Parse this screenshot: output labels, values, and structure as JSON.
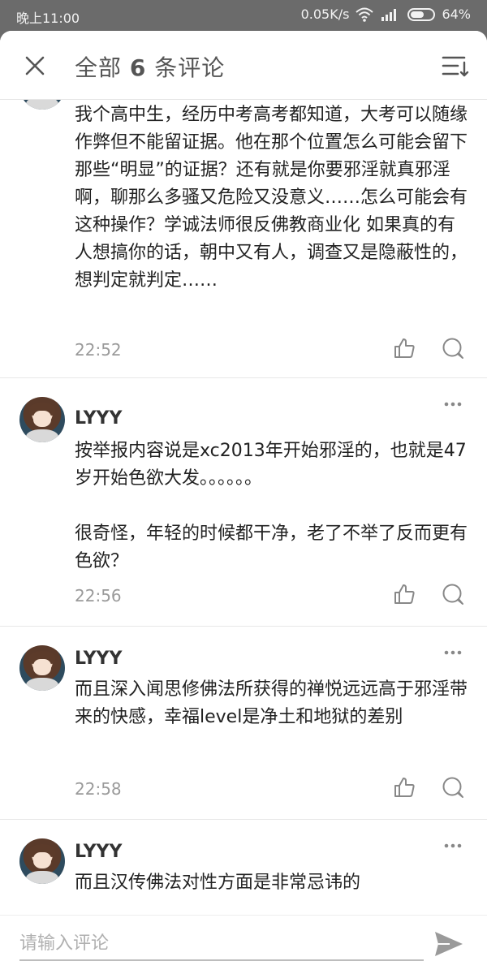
{
  "status_bar": {
    "time": "晚上11:00",
    "network_speed": "0.05K/s",
    "battery": "64%"
  },
  "header": {
    "title_prefix": "全部 ",
    "count": "6",
    "title_suffix": " 条评论"
  },
  "comments": [
    {
      "username": "",
      "text": "我个高中生，经历中考高考都知道，大考可以随缘作弊但不能留证据。他在那个位置怎么可能会留下那些“明显”的证据？还有就是你要邪淫就真邪淫啊，聊那么多骚又危险又没意义……怎么可能会有这种操作？学诚法师很反佛教商业化 如果真的有人想搞你的话，朝中又有人，调查又是隐蔽性的，想判定就判定……",
      "time": "22:52"
    },
    {
      "username": "LYYY",
      "text": "按举报内容说是xc2013年开始邪淫的，也就是47岁开始色欲大发。。。。。。\n\n很奇怪，年轻的时候都干净，老了不举了反而更有色欲？",
      "time": "22:56"
    },
    {
      "username": "LYYY",
      "text": "而且深入闻思修佛法所获得的禅悦远远高于邪淫带来的快感，幸福level是净土和地狱的差别",
      "time": "22:58"
    },
    {
      "username": "LYYY",
      "text": "而且汉传佛法对性方面是非常忌讳的",
      "time": ""
    }
  ],
  "footer": {
    "input_placeholder": "请输入评论"
  },
  "colors": {
    "overlay": "#6b6b6b",
    "text": "#222222",
    "muted": "#9a9a9a"
  }
}
